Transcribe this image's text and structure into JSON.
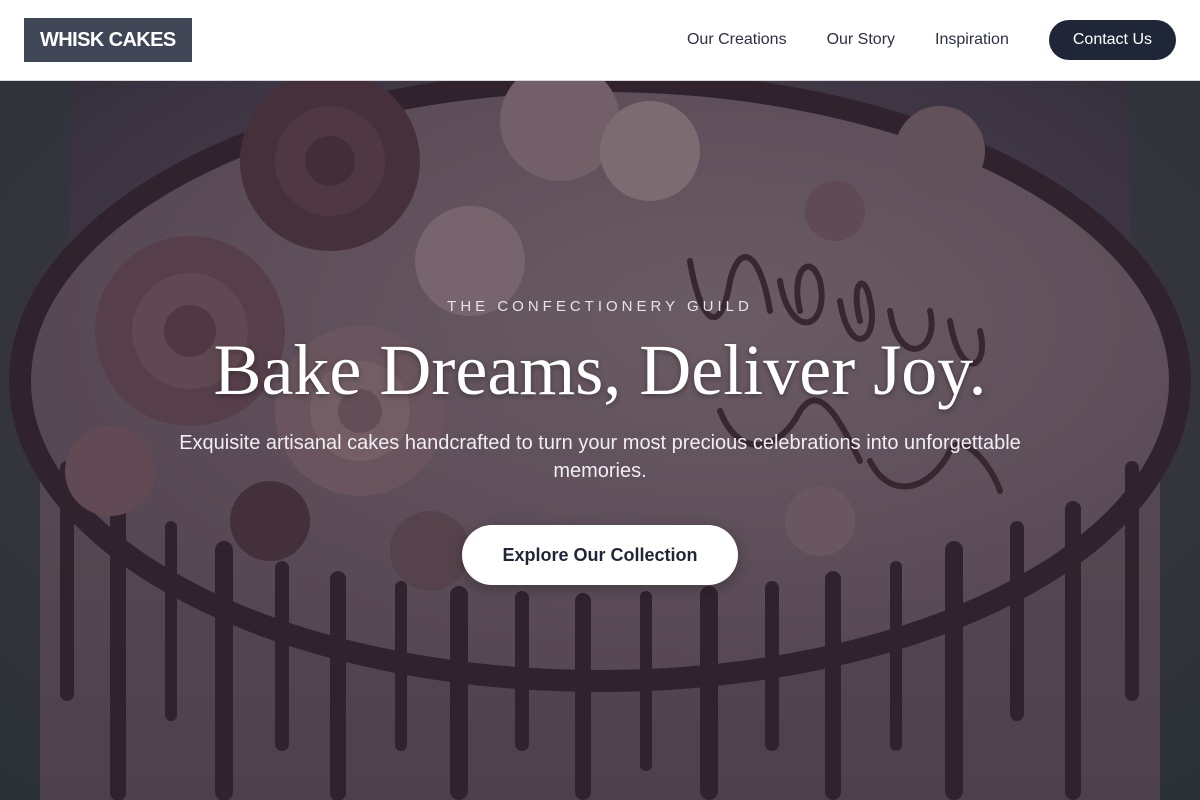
{
  "header": {
    "logo": "WHISK CAKES",
    "nav": [
      "Our Creations",
      "Our Story",
      "Inspiration"
    ],
    "contact_label": "Contact Us"
  },
  "hero": {
    "eyebrow": "THE CONFECTIONERY GUILD",
    "headline": "Bake Dreams, Deliver Joy.",
    "subtitle": "Exquisite artisanal cakes handcrafted to turn your most precious celebrations into unforgettable memories.",
    "cta_label": "Explore Our Collection",
    "background_image": "cake-photo",
    "overlay_color": "#1c1828"
  },
  "colors": {
    "primary": "#1e2638",
    "logo_bg": "#3f4656"
  }
}
